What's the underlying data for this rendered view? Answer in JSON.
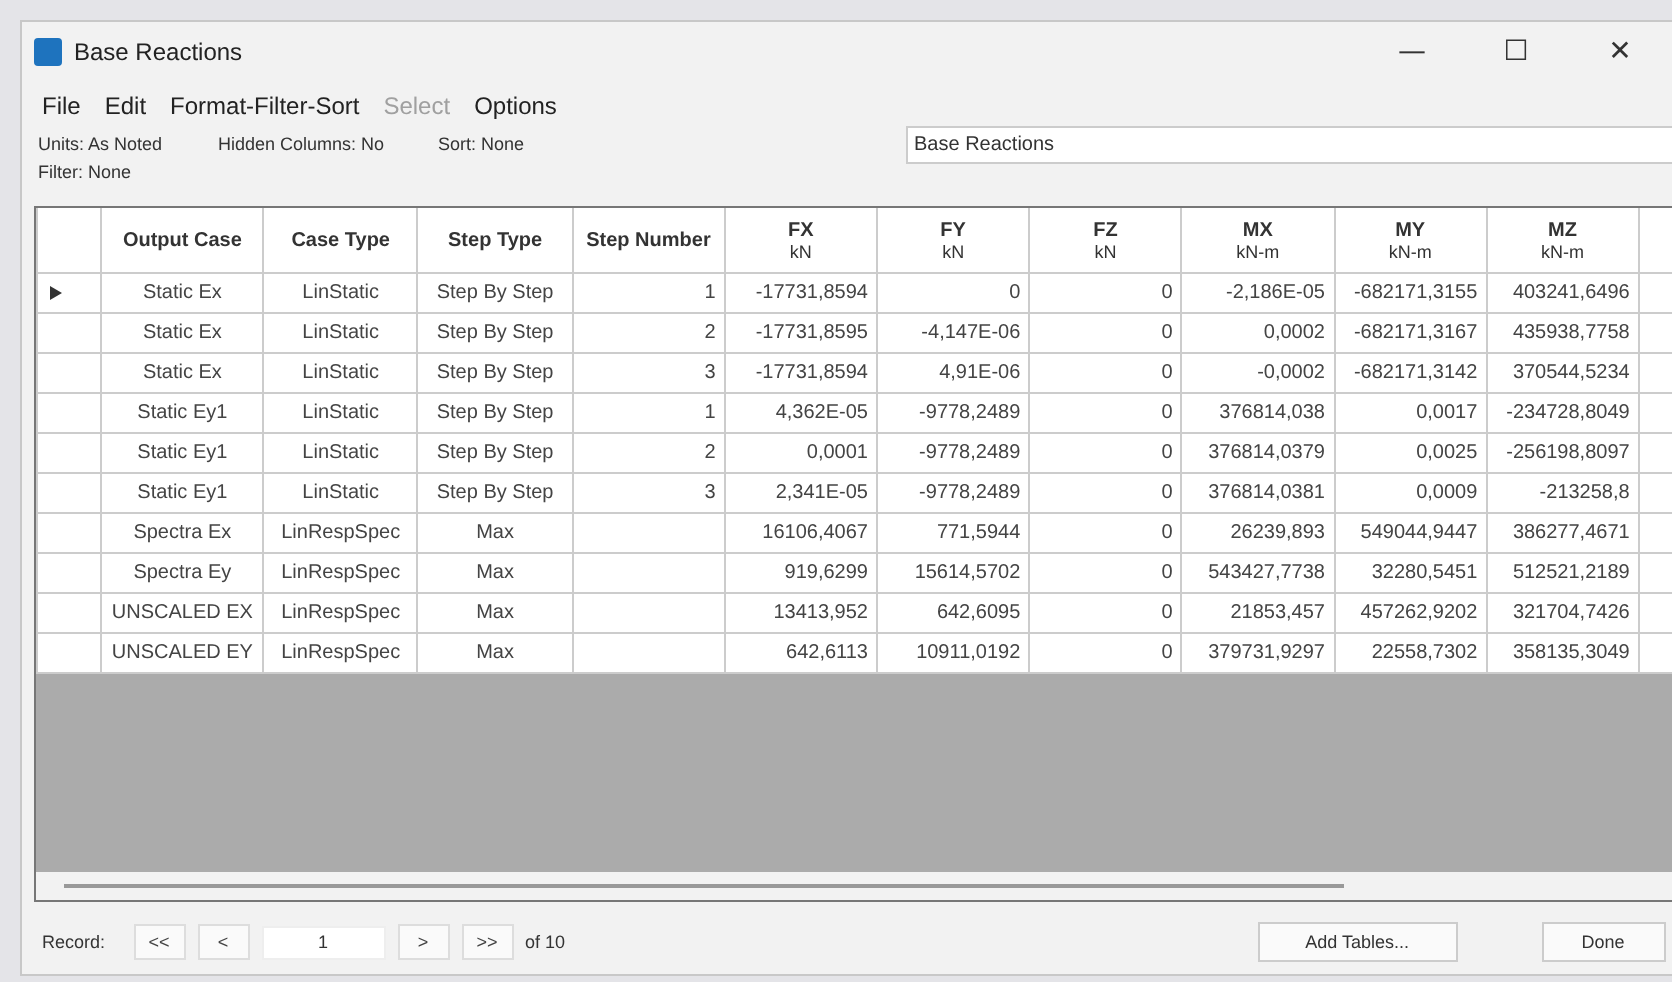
{
  "window": {
    "title": "Base Reactions",
    "controls": [
      "—",
      "☐",
      "✕"
    ]
  },
  "menu": [
    {
      "label": "File",
      "disabled": false
    },
    {
      "label": "Edit",
      "disabled": false
    },
    {
      "label": "Format-Filter-Sort",
      "disabled": false
    },
    {
      "label": "Select",
      "disabled": true
    },
    {
      "label": "Options",
      "disabled": false
    }
  ],
  "info": {
    "units": "Units: As Noted",
    "hidden_columns": "Hidden Columns: No",
    "sort": "Sort: None",
    "filter": "Filter: None",
    "table_name": "Base Reactions"
  },
  "table": {
    "columns": [
      {
        "name": "Output Case"
      },
      {
        "name": "Case Type"
      },
      {
        "name": "Step Type"
      },
      {
        "name": "Step Number"
      },
      {
        "name": "FX",
        "unit": "kN"
      },
      {
        "name": "FY",
        "unit": "kN"
      },
      {
        "name": "FZ",
        "unit": "kN"
      },
      {
        "name": "MX",
        "unit": "kN-m"
      },
      {
        "name": "MY",
        "unit": "kN-m"
      },
      {
        "name": "MZ",
        "unit": "kN-m"
      }
    ],
    "rows": [
      {
        "current": true,
        "cells": [
          "Static Ex",
          "LinStatic",
          "Step By Step",
          "1",
          "-17731,8594",
          "0",
          "0",
          "-2,186E-05",
          "-682171,3155",
          "403241,6496"
        ]
      },
      {
        "current": false,
        "cells": [
          "Static Ex",
          "LinStatic",
          "Step By Step",
          "2",
          "-17731,8595",
          "-4,147E-06",
          "0",
          "0,0002",
          "-682171,3167",
          "435938,7758"
        ]
      },
      {
        "current": false,
        "cells": [
          "Static Ex",
          "LinStatic",
          "Step By Step",
          "3",
          "-17731,8594",
          "4,91E-06",
          "0",
          "-0,0002",
          "-682171,3142",
          "370544,5234"
        ]
      },
      {
        "current": false,
        "cells": [
          "Static Ey1",
          "LinStatic",
          "Step By Step",
          "1",
          "4,362E-05",
          "-9778,2489",
          "0",
          "376814,038",
          "0,0017",
          "-234728,8049"
        ]
      },
      {
        "current": false,
        "cells": [
          "Static Ey1",
          "LinStatic",
          "Step By Step",
          "2",
          "0,0001",
          "-9778,2489",
          "0",
          "376814,0379",
          "0,0025",
          "-256198,8097"
        ]
      },
      {
        "current": false,
        "cells": [
          "Static Ey1",
          "LinStatic",
          "Step By Step",
          "3",
          "2,341E-05",
          "-9778,2489",
          "0",
          "376814,0381",
          "0,0009",
          "-213258,8"
        ]
      },
      {
        "current": false,
        "cells": [
          "Spectra Ex",
          "LinRespSpec",
          "Max",
          "",
          "16106,4067",
          "771,5944",
          "0",
          "26239,893",
          "549044,9447",
          "386277,4671"
        ]
      },
      {
        "current": false,
        "cells": [
          "Spectra Ey",
          "LinRespSpec",
          "Max",
          "",
          "919,6299",
          "15614,5702",
          "0",
          "543427,7738",
          "32280,5451",
          "512521,2189"
        ]
      },
      {
        "current": false,
        "cells": [
          "UNSCALED EX",
          "LinRespSpec",
          "Max",
          "",
          "13413,952",
          "642,6095",
          "0",
          "21853,457",
          "457262,9202",
          "321704,7426"
        ]
      },
      {
        "current": false,
        "cells": [
          "UNSCALED EY",
          "LinRespSpec",
          "Max",
          "",
          "642,6113",
          "10911,0192",
          "0",
          "379731,9297",
          "22558,7302",
          "358135,3049"
        ]
      }
    ]
  },
  "record": {
    "label": "Record:",
    "first": "<<",
    "prev": "<",
    "value": "1",
    "next": ">",
    "last": ">>",
    "total": "of 10"
  },
  "buttons": [
    "Add Tables...",
    "Done"
  ]
}
